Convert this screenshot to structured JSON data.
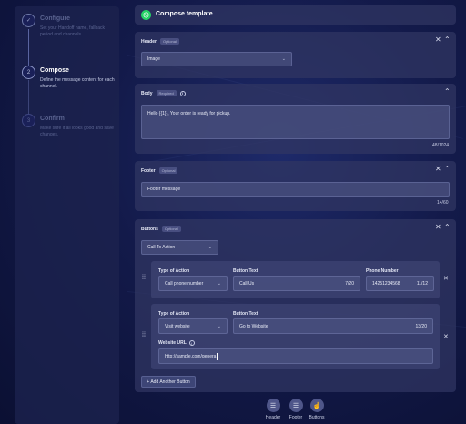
{
  "steps": [
    {
      "num": "✓",
      "title": "Configure",
      "desc": "Set your Handoff name, fallback period and channels."
    },
    {
      "num": "2",
      "title": "Compose",
      "desc": "Define the message content for each channel."
    },
    {
      "num": "3",
      "title": "Confirm",
      "desc": "Make sure it all looks good and save changes."
    }
  ],
  "header_bar": {
    "title": "Compose template",
    "icon": "whatsapp-icon"
  },
  "header_section": {
    "title": "Header",
    "badge": "Optional",
    "type_value": "Image"
  },
  "body_section": {
    "title": "Body",
    "badge": "Required",
    "message": "Hello {{1}}, Your order is ready for pickup.",
    "counter": "48/1024"
  },
  "footer_section": {
    "title": "Footer",
    "badge": "Optional",
    "message": "Footer message",
    "counter": "14/60"
  },
  "buttons_section": {
    "title": "Buttons",
    "badge": "Optional",
    "button_type": "Call To Action",
    "call_button": {
      "type_label": "Type of Action",
      "type_value": "Call phone number",
      "text_label": "Button Text",
      "text_value": "Call Us",
      "text_counter": "7/20",
      "phone_label": "Phone Number",
      "phone_value": "14251234568",
      "phone_counter": "11/12"
    },
    "web_button": {
      "type_label": "Type of Action",
      "type_value": "Visit website",
      "text_label": "Button Text",
      "text_value": "Go to Website",
      "text_counter": "13/20",
      "url_label": "Website URL",
      "url_value": "http://sample.com/genera"
    },
    "add_label": "+ Add Another Button"
  },
  "bottom_bar": [
    {
      "label": "Header",
      "icon": "header-icon"
    },
    {
      "label": "Footer",
      "icon": "footer-icon"
    },
    {
      "label": "Buttons",
      "icon": "buttons-icon"
    }
  ],
  "colors": {
    "accent_green": "#25d366",
    "panel": "#1c224e",
    "card": "#30365f"
  }
}
